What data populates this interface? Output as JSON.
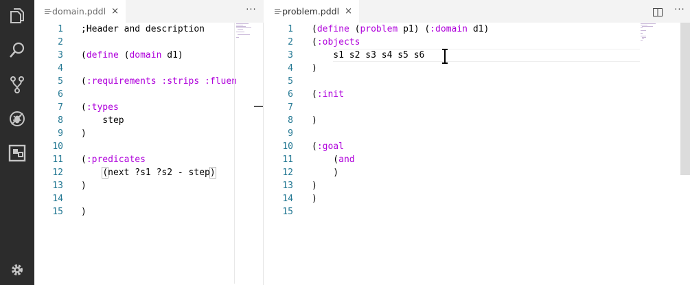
{
  "activity_bar": {
    "items": [
      {
        "name": "explorer-icon"
      },
      {
        "name": "search-icon"
      },
      {
        "name": "source-control-icon"
      },
      {
        "name": "debug-icon"
      },
      {
        "name": "extensions-icon"
      }
    ],
    "bottom": {
      "name": "settings-gear-icon"
    }
  },
  "left_editor": {
    "tab": {
      "filename": "domain.pddl",
      "close": "×"
    },
    "more": "···",
    "lines": [
      {
        "n": "1",
        "tokens": [
          {
            "t": ";Header and description",
            "k": "p"
          }
        ]
      },
      {
        "n": "2",
        "tokens": []
      },
      {
        "n": "3",
        "tokens": [
          {
            "t": "(",
            "k": "p"
          },
          {
            "t": "define",
            "k": "k"
          },
          {
            "t": " (",
            "k": "p"
          },
          {
            "t": "domain",
            "k": "k"
          },
          {
            "t": " d1)",
            "k": "p"
          }
        ]
      },
      {
        "n": "4",
        "tokens": []
      },
      {
        "n": "5",
        "tokens": [
          {
            "t": "(",
            "k": "p"
          },
          {
            "t": ":requirements",
            "k": "k"
          },
          {
            "t": " ",
            "k": "p"
          },
          {
            "t": ":strips",
            "k": "k"
          },
          {
            "t": " ",
            "k": "p"
          },
          {
            "t": ":fluen",
            "k": "k"
          }
        ]
      },
      {
        "n": "6",
        "tokens": []
      },
      {
        "n": "7",
        "tokens": [
          {
            "t": "(",
            "k": "p"
          },
          {
            "t": ":types",
            "k": "k"
          }
        ]
      },
      {
        "n": "8",
        "tokens": [
          {
            "t": "    step",
            "k": "p"
          }
        ]
      },
      {
        "n": "9",
        "tokens": [
          {
            "t": ")",
            "k": "p"
          }
        ]
      },
      {
        "n": "10",
        "tokens": []
      },
      {
        "n": "11",
        "tokens": [
          {
            "t": "(",
            "k": "p"
          },
          {
            "t": ":predicates",
            "k": "k"
          }
        ]
      },
      {
        "n": "12",
        "tokens": [
          {
            "t": "    ",
            "k": "p"
          },
          {
            "t": "(",
            "k": "b"
          },
          {
            "t": "next ?s1 ?s2 - step",
            "k": "p"
          },
          {
            "t": ")",
            "k": "b"
          }
        ]
      },
      {
        "n": "13",
        "tokens": [
          {
            "t": ")",
            "k": "p"
          }
        ]
      },
      {
        "n": "14",
        "tokens": []
      },
      {
        "n": "15",
        "tokens": [
          {
            "t": ")",
            "k": "p"
          }
        ]
      }
    ]
  },
  "right_editor": {
    "tab": {
      "filename": "problem.pddl",
      "close": "×"
    },
    "more": "···",
    "lines": [
      {
        "n": "1",
        "tokens": [
          {
            "t": "(",
            "k": "p"
          },
          {
            "t": "define",
            "k": "k"
          },
          {
            "t": " (",
            "k": "p"
          },
          {
            "t": "problem",
            "k": "k"
          },
          {
            "t": " p1) (",
            "k": "p"
          },
          {
            "t": ":domain",
            "k": "k"
          },
          {
            "t": " d1)",
            "k": "p"
          }
        ]
      },
      {
        "n": "2",
        "tokens": [
          {
            "t": "(",
            "k": "p"
          },
          {
            "t": ":objects",
            "k": "k"
          }
        ]
      },
      {
        "n": "3",
        "tokens": [
          {
            "t": "    s1 s2 s3 s4 s5 s6",
            "k": "p"
          }
        ]
      },
      {
        "n": "4",
        "tokens": [
          {
            "t": ")",
            "k": "p"
          }
        ]
      },
      {
        "n": "5",
        "tokens": []
      },
      {
        "n": "6",
        "tokens": [
          {
            "t": "(",
            "k": "p"
          },
          {
            "t": ":init",
            "k": "k"
          }
        ]
      },
      {
        "n": "7",
        "tokens": []
      },
      {
        "n": "8",
        "tokens": [
          {
            "t": ")",
            "k": "p"
          }
        ]
      },
      {
        "n": "9",
        "tokens": []
      },
      {
        "n": "10",
        "tokens": [
          {
            "t": "(",
            "k": "p"
          },
          {
            "t": ":goal",
            "k": "k"
          }
        ]
      },
      {
        "n": "11",
        "tokens": [
          {
            "t": "    (",
            "k": "p"
          },
          {
            "t": "and",
            "k": "k"
          }
        ]
      },
      {
        "n": "12",
        "tokens": [
          {
            "t": "    )",
            "k": "p"
          }
        ]
      },
      {
        "n": "13",
        "tokens": [
          {
            "t": ")",
            "k": "p"
          }
        ]
      },
      {
        "n": "14",
        "tokens": [
          {
            "t": ")",
            "k": "p"
          }
        ]
      },
      {
        "n": "15",
        "tokens": []
      }
    ]
  },
  "colors": {
    "activity_bar": "#2c2c2c",
    "activity_icon": "#c5c5c5",
    "line_number": "#237893",
    "keyword": "#af00db",
    "text": "#000000",
    "tab_bar": "#f3f3f3"
  }
}
